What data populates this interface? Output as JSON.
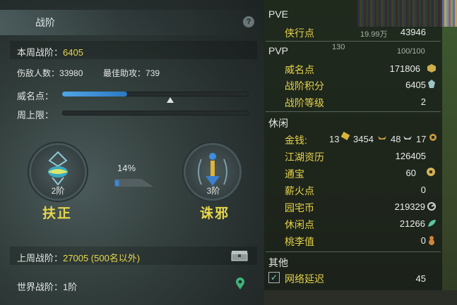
{
  "left": {
    "title": "战阶",
    "help_symbol": "?",
    "weekly": {
      "label": "本周战阶：",
      "value": "6405"
    },
    "damage": {
      "label": "伤敌人数：",
      "value": "33980"
    },
    "best_assist": {
      "label": "最佳助攻：",
      "value": "739"
    },
    "fame": {
      "label": "威名点：",
      "progress": 0.35,
      "marker": 0.58
    },
    "weekly_cap": {
      "label": "周上限：",
      "progress": 0.0
    },
    "rank_left": {
      "rank": "2阶",
      "name": "扶正"
    },
    "rank_right": {
      "rank": "3阶",
      "name": "诛邪"
    },
    "progress_label": "14%",
    "progress_value": 0.14,
    "last_week": {
      "label": "上周战阶：",
      "value": "27005 (500名以外)"
    },
    "world": {
      "label": "世界战阶：",
      "value": "1阶"
    }
  },
  "right": {
    "top_numbers": [
      "19.99万",
      "130",
      "100/100"
    ],
    "pve": {
      "title": "PVE",
      "items": [
        {
          "label": "侠行点",
          "value": "43946"
        }
      ]
    },
    "pvp": {
      "title": "PVP",
      "items": [
        {
          "label": "威名点",
          "value": "171806"
        },
        {
          "label": "战阶积分",
          "value": "6405"
        },
        {
          "label": "战阶等级",
          "value": "2"
        }
      ]
    },
    "leisure": {
      "title": "休闲",
      "money": {
        "label": "金钱:",
        "gold": "13",
        "silver": "3454",
        "copper": "48",
        "tin": "17"
      },
      "items": [
        {
          "label": "江湖资历",
          "value": "126405"
        },
        {
          "label": "通宝",
          "value": "60"
        },
        {
          "label": "薪火点",
          "value": "0"
        },
        {
          "label": "园宅币",
          "value": "219329"
        },
        {
          "label": "休闲点",
          "value": "21266"
        },
        {
          "label": "桃李值",
          "value": "0"
        }
      ]
    },
    "other": {
      "title": "其他",
      "network": {
        "label": "网络延迟",
        "value": "45",
        "checked": true
      }
    }
  },
  "colors": {
    "accent_yellow": "#e7d64c",
    "bar_blue": "#3a8fd6"
  }
}
